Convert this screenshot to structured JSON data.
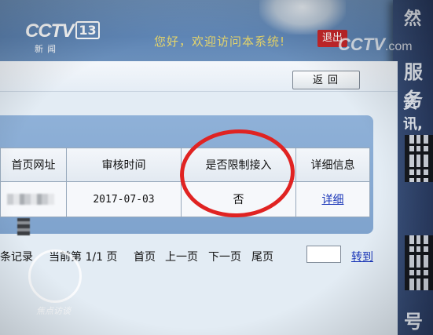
{
  "channel_logo": {
    "brand": "CCTV",
    "channel_number": "13",
    "subtitle": "新闻"
  },
  "watermark": {
    "brand": "CCTV",
    "suffix": ".com"
  },
  "program_logo": {
    "name": "焦点访谈"
  },
  "header": {
    "welcome": "您好，欢迎访问本系统!",
    "logout_label": "退出"
  },
  "toolbar": {
    "back_label": "返回"
  },
  "table": {
    "columns": [
      "首页网址",
      "审核时间",
      "是否限制接入",
      "详细信息"
    ],
    "rows": [
      {
        "homepage_url": "",
        "review_time": "2017-07-03",
        "restricted_access": "否",
        "details_link": "详细"
      }
    ]
  },
  "pagination": {
    "records_text": "条记录",
    "current_page_text": "当前第 1/1 页",
    "first_label": "首页",
    "prev_label": "上一页",
    "next_label": "下一页",
    "last_label": "尾页",
    "goto_label": "转到"
  },
  "side_poster": {
    "text_lines": [
      "然",
      "服务",
      "资讯,",
      "号"
    ]
  },
  "colors": {
    "banner_blue": "#5f86b6",
    "logout_red": "#c8272a",
    "highlight_red": "#e02322",
    "link_blue": "#1a36b8"
  }
}
